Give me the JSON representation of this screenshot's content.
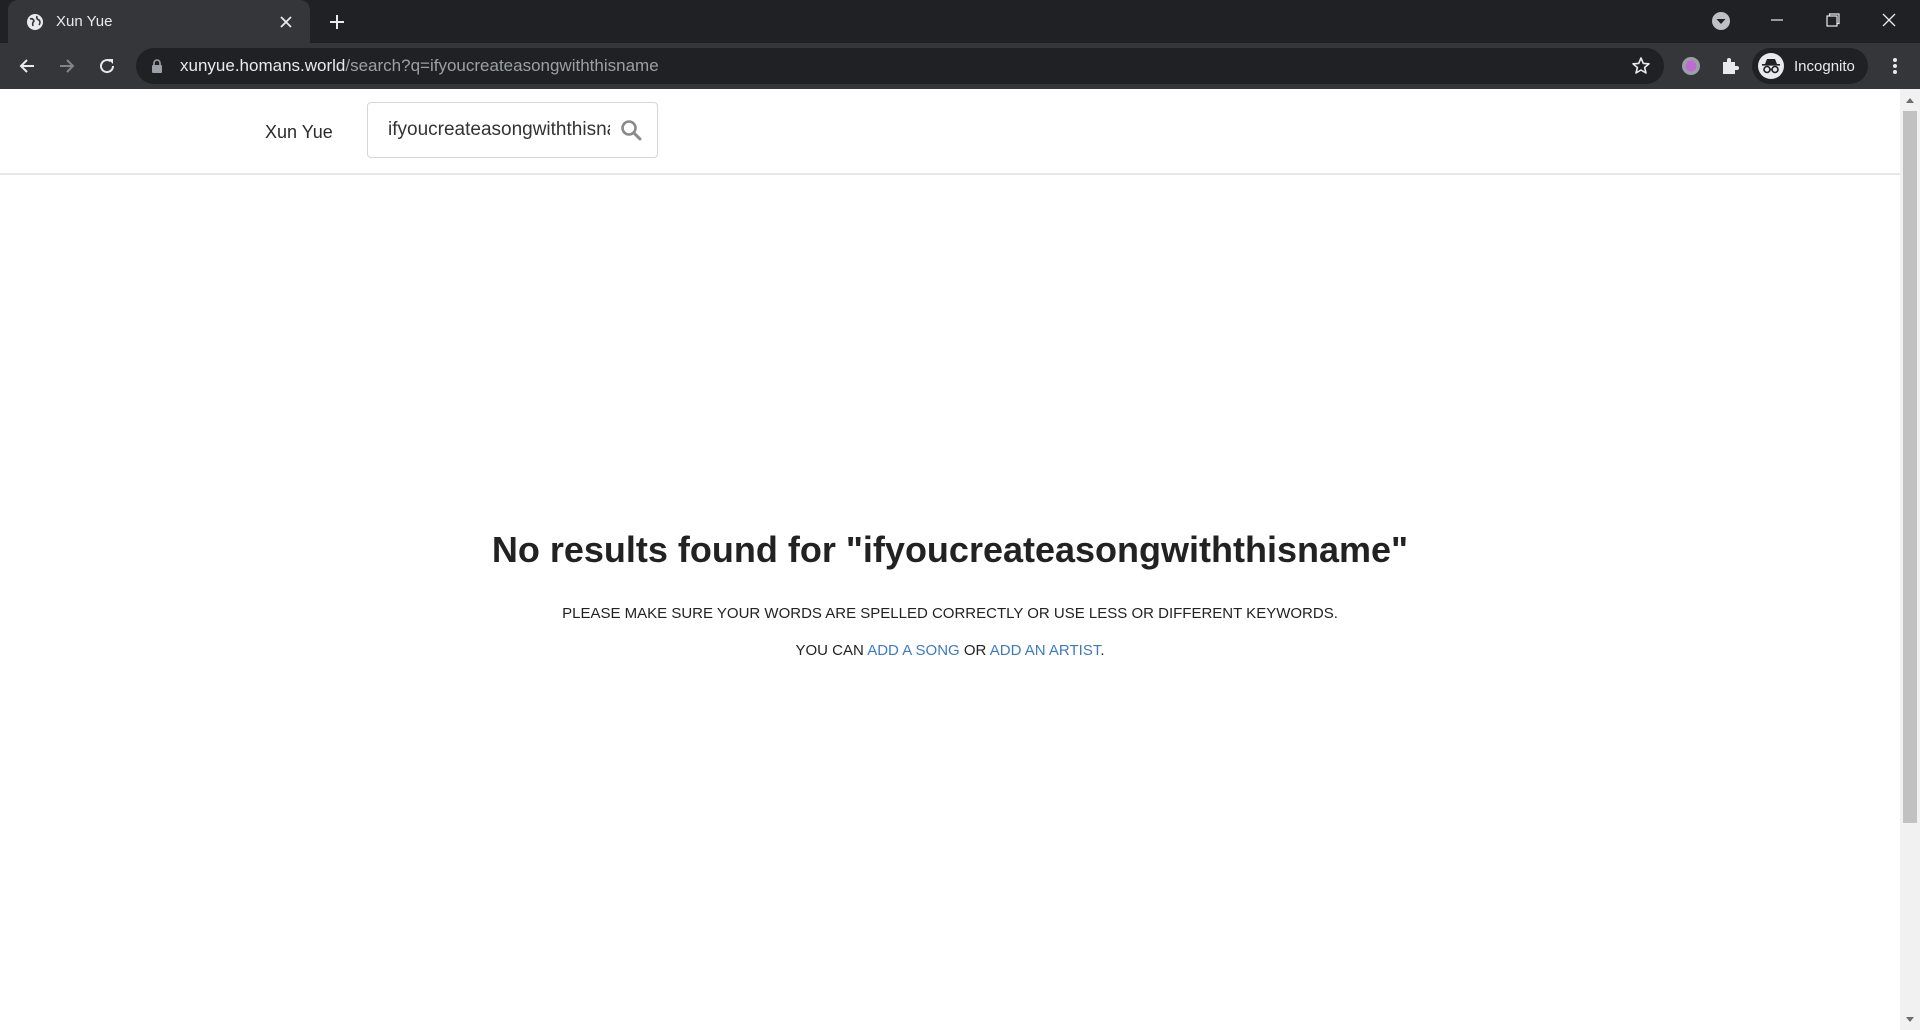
{
  "browser": {
    "tab_title": "Xun Yue",
    "url_host": "xunyue.homans.world",
    "url_path": "/search?q=ifyoucreateasongwiththisname",
    "profile_label": "Incognito"
  },
  "site": {
    "brand": "Xun Yue",
    "search_value": "ifyoucreateasongwiththisname"
  },
  "results": {
    "heading": "No results found for \"ifyoucreateasongwiththisname\"",
    "hint": "PLEASE MAKE SURE YOUR WORDS ARE SPELLED CORRECTLY OR USE LESS OR DIFFERENT KEYWORDS.",
    "you_can": "YOU CAN",
    "add_song_link": "ADD A SONG",
    "or_text": "OR",
    "add_artist_link": "ADD AN ARTIST",
    "period": "."
  },
  "colors": {
    "chrome_dark": "#202124",
    "chrome_toolbar": "#35363a",
    "link": "#3d7bc0",
    "text": "#222222"
  },
  "icons": [
    "globe-icon",
    "close-icon",
    "plus-icon",
    "minimize-icon",
    "restore-icon",
    "back-icon",
    "forward-icon",
    "reload-icon",
    "lock-icon",
    "star-icon",
    "extension-icon",
    "puzzle-icon",
    "incognito-icon",
    "more-vert-icon",
    "search-icon"
  ]
}
